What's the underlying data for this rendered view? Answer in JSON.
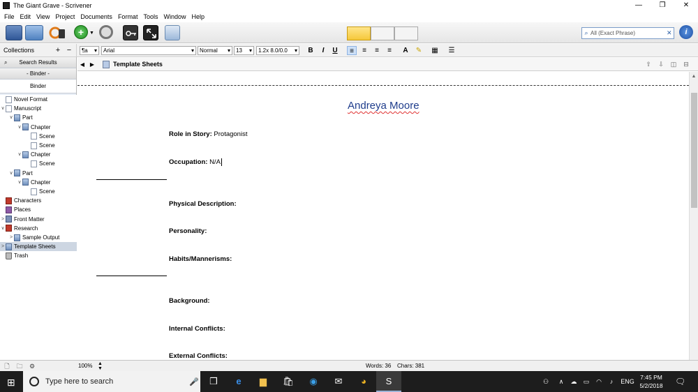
{
  "window": {
    "title": "The Giant Grave - Scrivener"
  },
  "menu": [
    "File",
    "Edit",
    "View",
    "Project",
    "Documents",
    "Format",
    "Tools",
    "Window",
    "Help"
  ],
  "search": {
    "placeholder": "All (Exact Phrase)"
  },
  "formatbar": {
    "collections_label": "Collections",
    "plus": "+",
    "minus": "−",
    "style": "¶a",
    "font": "Arial",
    "typeface": "Normal",
    "size": "13",
    "spacing": "1.2x 8.0/0.0",
    "bold": "B",
    "italic": "I",
    "underline": "U"
  },
  "sidebar": {
    "search_results": "Search Results",
    "binder_tab": "- Binder -",
    "binder_header": "Binder",
    "items": [
      {
        "label": "Novel Format",
        "indent": 0,
        "twisty": "",
        "icon": "doc-icon"
      },
      {
        "label": "Manuscript",
        "indent": 0,
        "twisty": "∨",
        "icon": "manuscript-icon"
      },
      {
        "label": "Part",
        "indent": 1,
        "twisty": "∨",
        "icon": "folder-icon"
      },
      {
        "label": "Chapter",
        "indent": 2,
        "twisty": "∨",
        "icon": "folder-icon"
      },
      {
        "label": "Scene",
        "indent": 3,
        "twisty": "",
        "icon": "doc-icon"
      },
      {
        "label": "Scene",
        "indent": 3,
        "twisty": "",
        "icon": "doc-icon"
      },
      {
        "label": "Chapter",
        "indent": 2,
        "twisty": "∨",
        "icon": "folder-icon"
      },
      {
        "label": "Scene",
        "indent": 3,
        "twisty": "",
        "icon": "doc-icon"
      },
      {
        "label": "Part",
        "indent": 1,
        "twisty": "∨",
        "icon": "folder-icon"
      },
      {
        "label": "Chapter",
        "indent": 2,
        "twisty": "∨",
        "icon": "folder-icon"
      },
      {
        "label": "Scene",
        "indent": 3,
        "twisty": "",
        "icon": "doc-icon"
      },
      {
        "label": "Characters",
        "indent": 0,
        "twisty": "",
        "icon": "characters-icon"
      },
      {
        "label": "Places",
        "indent": 0,
        "twisty": "",
        "icon": "places-icon"
      },
      {
        "label": "Front Matter",
        "indent": 0,
        "twisty": ">",
        "icon": "book-icon"
      },
      {
        "label": "Research",
        "indent": 0,
        "twisty": "∨",
        "icon": "research-icon"
      },
      {
        "label": "Sample Output",
        "indent": 1,
        "twisty": ">",
        "icon": "folder-icon"
      },
      {
        "label": "Template Sheets",
        "indent": 0,
        "twisty": ">",
        "icon": "template-icon",
        "selected": true
      },
      {
        "label": "Trash",
        "indent": 0,
        "twisty": "",
        "icon": "trash-icon"
      }
    ]
  },
  "editor": {
    "header_title": "Template Sheets",
    "document_title": "Andreya Moore",
    "role_label": "Role in Story:",
    "role_value": "Protagonist",
    "occupation_label": "Occupation:",
    "occupation_value": "N/A",
    "physical_label": "Physical Description:",
    "personality_label": "Personality:",
    "habits_label": "Habits/Mannerisms:",
    "background_label": "Background:",
    "internal_label": "Internal Conflicts:",
    "external_label": "External Conflicts:"
  },
  "footer": {
    "zoom": "100%",
    "words": "Words: 36",
    "chars": "Chars: 381"
  },
  "taskbar": {
    "search_placeholder": "Type here to search",
    "language": "ENG",
    "time": "7:45 PM",
    "date": "5/2/2018"
  }
}
